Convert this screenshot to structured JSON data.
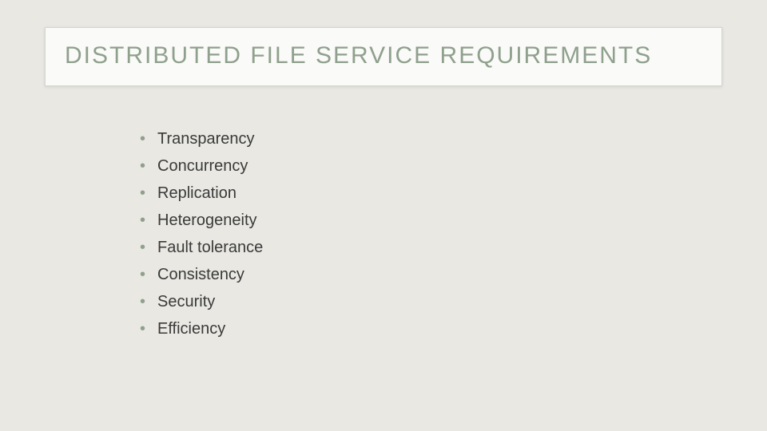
{
  "title": "DISTRIBUTED FILE SERVICE REQUIREMENTS",
  "bullets": [
    "Transparency",
    "Concurrency",
    "Replication",
    "Heterogeneity",
    "Fault tolerance",
    "Consistency",
    "Security",
    "Efficiency"
  ]
}
